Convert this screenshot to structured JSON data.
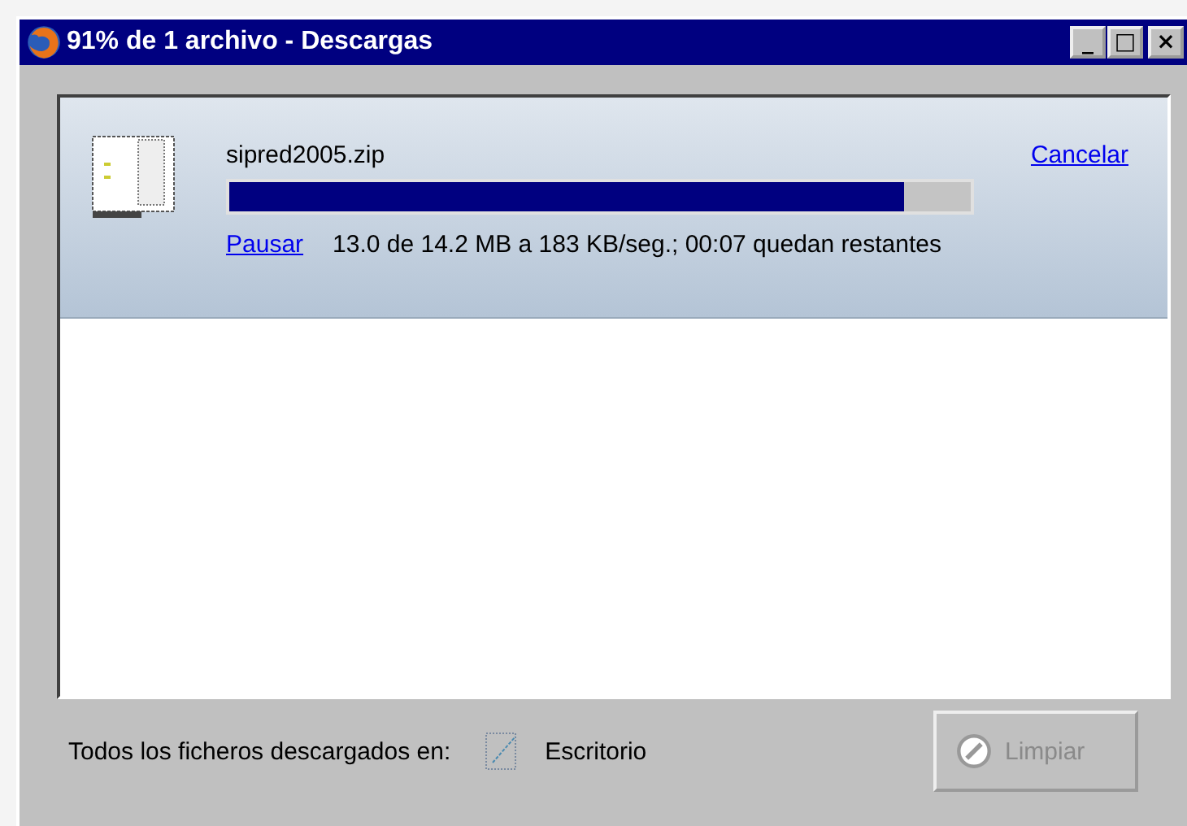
{
  "window": {
    "title": "91% de 1 archivo - Descargas",
    "controls": [
      "_",
      "□",
      "×"
    ]
  },
  "downloads": [
    {
      "filename": "sipred2005.zip",
      "level": 0.91,
      "cancel": "Cancelar",
      "pause": "Pausar",
      "status": "13.0 de 14.2 MB a 183 KB/seg.; 00:07 quedan restantes"
    }
  ],
  "footer": {
    "label": "Todos los ficheros descargados en:",
    "folder": "Escritorio",
    "clear_button": {
      "label": "Limpiar",
      "disabled": true
    }
  }
}
